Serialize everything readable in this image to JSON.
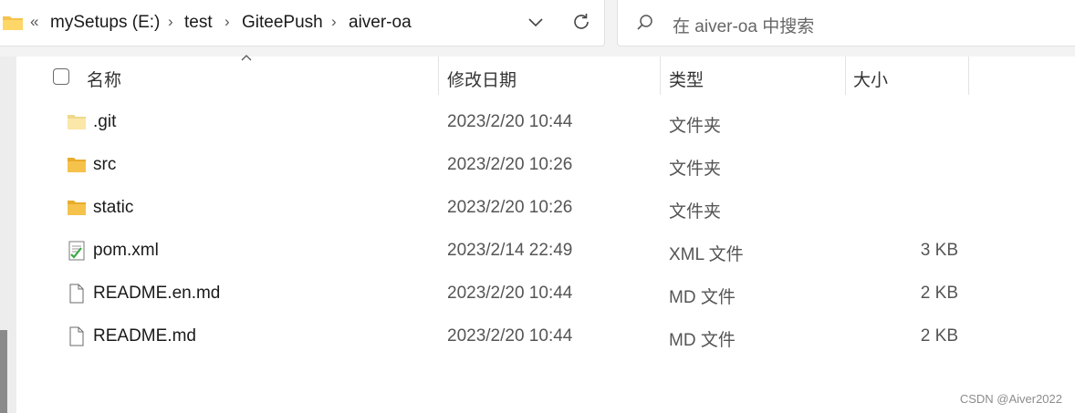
{
  "address_bar": {
    "overflow": "«",
    "crumbs": [
      "mySetups (E:)",
      "test",
      "GiteePush",
      "aiver-oa"
    ],
    "separator": "›"
  },
  "search": {
    "placeholder": "在 aiver-oa 中搜索"
  },
  "columns": {
    "name": "名称",
    "date": "修改日期",
    "type": "类型",
    "size": "大小"
  },
  "files": [
    {
      "name": ".git",
      "date": "2023/2/20 10:44",
      "type": "文件夹",
      "size": "",
      "icon": "folder-light-icon"
    },
    {
      "name": "src",
      "date": "2023/2/20 10:26",
      "type": "文件夹",
      "size": "",
      "icon": "folder-icon"
    },
    {
      "name": "static",
      "date": "2023/2/20 10:26",
      "type": "文件夹",
      "size": "",
      "icon": "folder-icon"
    },
    {
      "name": "pom.xml",
      "date": "2023/2/14 22:49",
      "type": "XML 文件",
      "size": "3 KB",
      "icon": "xml-file-icon"
    },
    {
      "name": "README.en.md",
      "date": "2023/2/20 10:44",
      "type": "MD 文件",
      "size": "2 KB",
      "icon": "document-icon"
    },
    {
      "name": "README.md",
      "date": "2023/2/20 10:44",
      "type": "MD 文件",
      "size": "2 KB",
      "icon": "document-icon"
    }
  ],
  "watermark": "CSDN @Aiver2022",
  "colors": {
    "folder": "#f5c24c",
    "folder_light": "#fbe7a8",
    "accent": "#0067c0"
  }
}
